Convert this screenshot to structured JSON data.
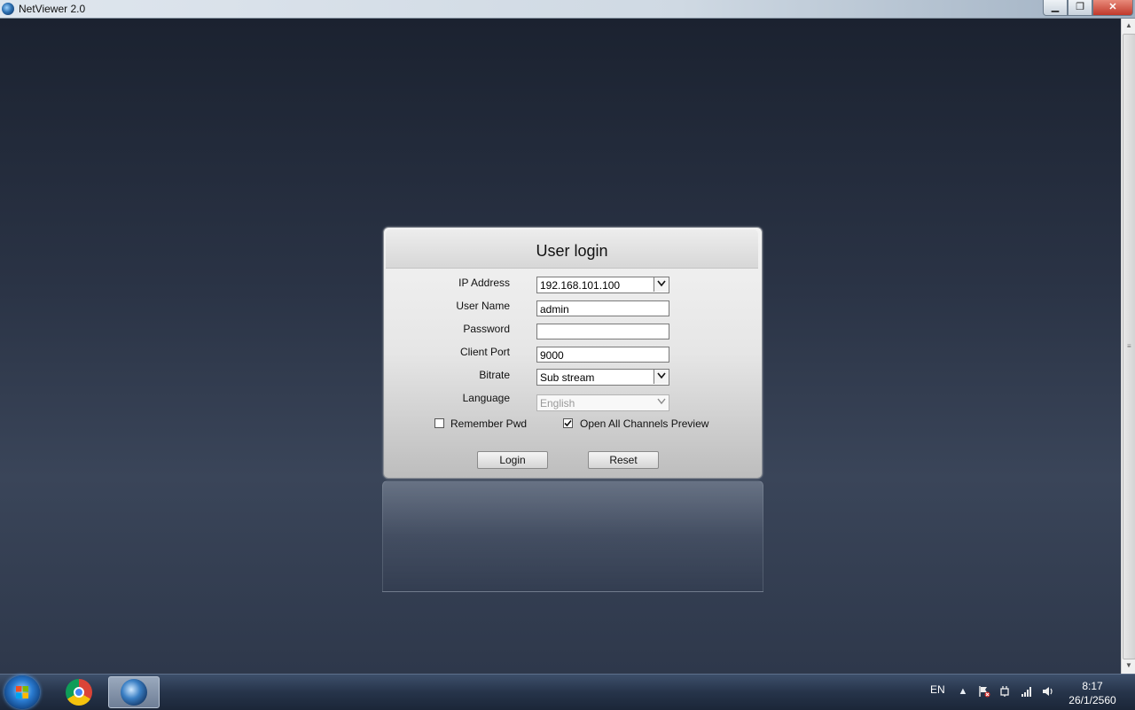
{
  "window": {
    "title": "NetViewer 2.0",
    "minimize_label": "▁",
    "restore_label": "❐",
    "close_label": "✕"
  },
  "dialog": {
    "title": "User login",
    "fields": {
      "ip_label": "IP Address",
      "ip_value": "192.168.101.100",
      "username_label": "User Name",
      "username_value": "admin",
      "password_label": "Password",
      "password_value": "",
      "port_label": "Client Port",
      "port_value": "9000",
      "bitrate_label": "Bitrate",
      "bitrate_value": "Sub stream",
      "language_label": "Language",
      "language_value": "English"
    },
    "remember_pwd": {
      "label": "Remember Pwd",
      "checked": false
    },
    "open_all_preview": {
      "label": "Open All Channels Preview",
      "checked": true
    },
    "login_label": "Login",
    "reset_label": "Reset"
  },
  "taskbar": {
    "lang": "EN",
    "time": "8:17",
    "date": "26/1/2560"
  },
  "colors": {
    "background": "#2a3345",
    "taskbar": "#26344a",
    "dialog": "#e6e6e6"
  }
}
